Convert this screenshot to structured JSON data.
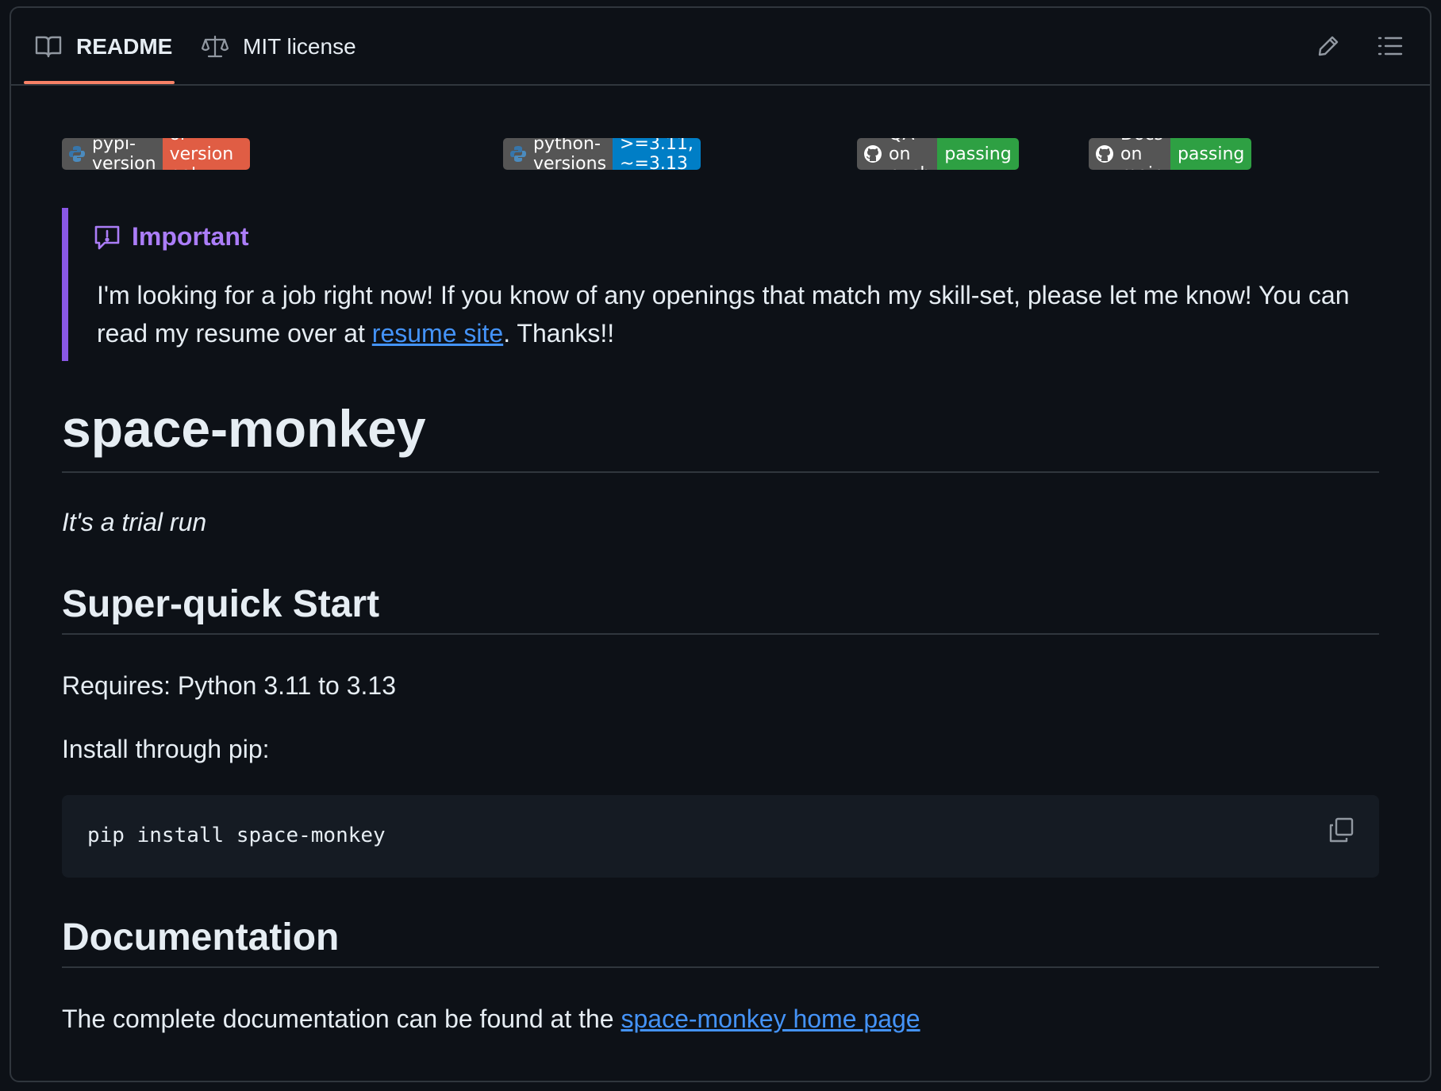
{
  "tabs": [
    {
      "label": "README",
      "icon": "book-icon",
      "active": true
    },
    {
      "label": "MIT license",
      "icon": "scale-icon",
      "active": false
    }
  ],
  "toolbar_icons": [
    "pencil-icon",
    "list-icon"
  ],
  "badges": [
    {
      "label": "pypi-version",
      "value": "package or version not found",
      "icon": "python-icon",
      "color": "#e05d44"
    },
    {
      "label": "python-versions",
      "value": ">=3.11, ~=3.13",
      "icon": "python-icon",
      "color": "#007ec6"
    },
    {
      "label": "QA on push",
      "value": "passing",
      "icon": "github-icon",
      "color": "#4c1"
    },
    {
      "label": "Docs on main",
      "value": "passing",
      "icon": "github-icon",
      "color": "#4c1"
    }
  ],
  "alert": {
    "title": "Important",
    "text_before": "I'm looking for a job right now! If you know of any openings that match my skill-set, please let me know! You can read my resume over at ",
    "link": "resume site",
    "text_after": ". Thanks!!"
  },
  "title": "space-monkey",
  "tagline": "It's a trial run",
  "quickstart": {
    "heading": "Super-quick Start",
    "requires": "Requires: Python 3.11 to 3.13",
    "install_label": "Install through pip:",
    "command": "pip install space-monkey"
  },
  "documentation": {
    "heading": "Documentation",
    "text": "The complete documentation can be found at the ",
    "link": "space-monkey home page"
  },
  "colors": {
    "background": "#0d1117",
    "accent_tab": "#f78166",
    "alert_purple": "#8957e5",
    "link": "#4493f8"
  }
}
